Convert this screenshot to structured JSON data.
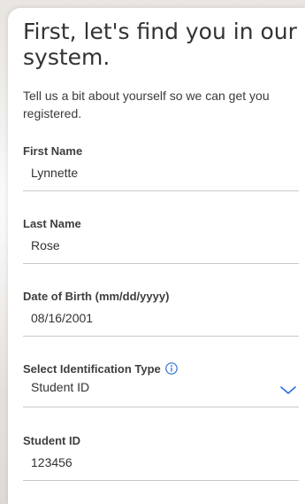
{
  "header": {
    "title": "First, let's find you in our system.",
    "intro": "Tell us a bit about yourself so we can get you registered."
  },
  "form": {
    "first_name": {
      "label": "First Name",
      "value": "Lynnette"
    },
    "last_name": {
      "label": "Last Name",
      "value": "Rose"
    },
    "dob": {
      "label": "Date of Birth (mm/dd/yyyy)",
      "value": "08/16/2001"
    },
    "id_type": {
      "label": "Select Identification Type",
      "value": "Student ID",
      "info_icon": "info-icon",
      "dropdown_icon": "chevron-down-icon"
    },
    "student_id": {
      "label": "Student ID",
      "value": "123456"
    }
  },
  "colors": {
    "accent": "#2a6fd6",
    "text": "#333333",
    "divider": "#c9c9c9"
  }
}
